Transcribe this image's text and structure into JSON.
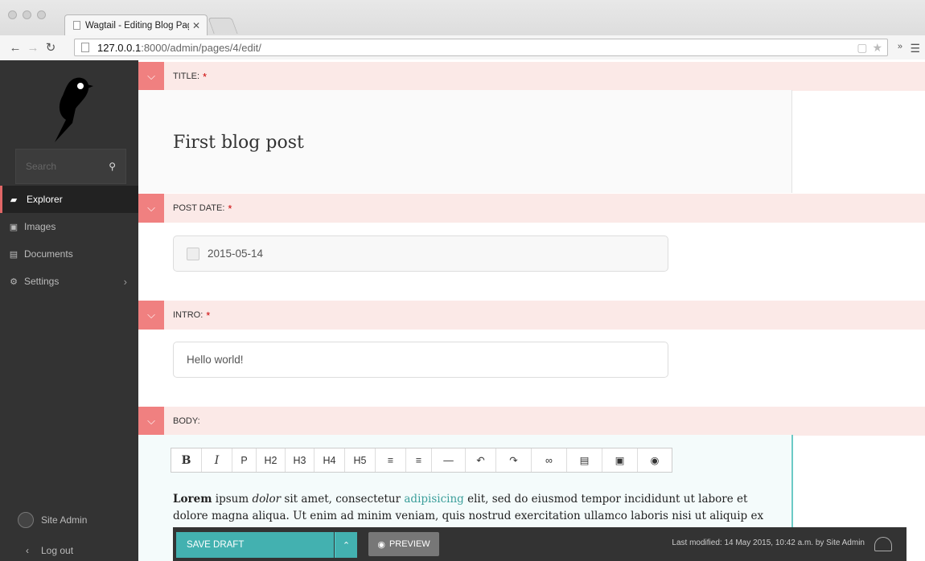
{
  "browser": {
    "tab_title": "Wagtail - Editing Blog Page",
    "url_host": "127.0.0.1",
    "url_path": ":8000/admin/pages/4/edit/"
  },
  "sidebar": {
    "search_placeholder": "Search",
    "items": [
      {
        "label": "Explorer",
        "icon": "folder-icon",
        "active": true
      },
      {
        "label": "Images",
        "icon": "image-icon"
      },
      {
        "label": "Documents",
        "icon": "document-icon"
      },
      {
        "label": "Settings",
        "icon": "cogs-icon"
      }
    ],
    "user_name": "Site Admin",
    "logout": "Log out"
  },
  "fields": {
    "title": {
      "label": "TITLE:",
      "required": "*",
      "value": "First blog post"
    },
    "date": {
      "label": "POST DATE:",
      "required": "*",
      "value": "2015-05-14"
    },
    "intro": {
      "label": "INTRO:",
      "required": "*",
      "value": "Hello world!"
    },
    "body": {
      "label": "BODY:"
    }
  },
  "rte_buttons": [
    "B",
    "I",
    "P",
    "H2",
    "H3",
    "H4",
    "H5",
    "≡",
    "≡",
    "—",
    "↶",
    "↷",
    "∞",
    "▤",
    "▣",
    "◉"
  ],
  "body_text": {
    "bold": "Lorem",
    "t1": " ipsum ",
    "italic": "dolor",
    "t2": " sit amet, consectetur ",
    "link": "adipisicing",
    "t3": " elit, sed do eiusmod  tempor incididunt ut labore et dolore magna aliqua. Ut enim ad minim veniam,  quis nostrud exercitation ullamco laboris nisi ut aliquip ex"
  },
  "footer": {
    "save": "SAVE DRAFT",
    "preview": "PREVIEW",
    "last_modified": "Last modified: 14 May 2015, 10:42 a.m. by Site Admin"
  },
  "colors": {
    "accent": "#43b1b0",
    "field_head": "#fbe9e7",
    "toggle": "#f08080",
    "sidebar": "#333333"
  }
}
